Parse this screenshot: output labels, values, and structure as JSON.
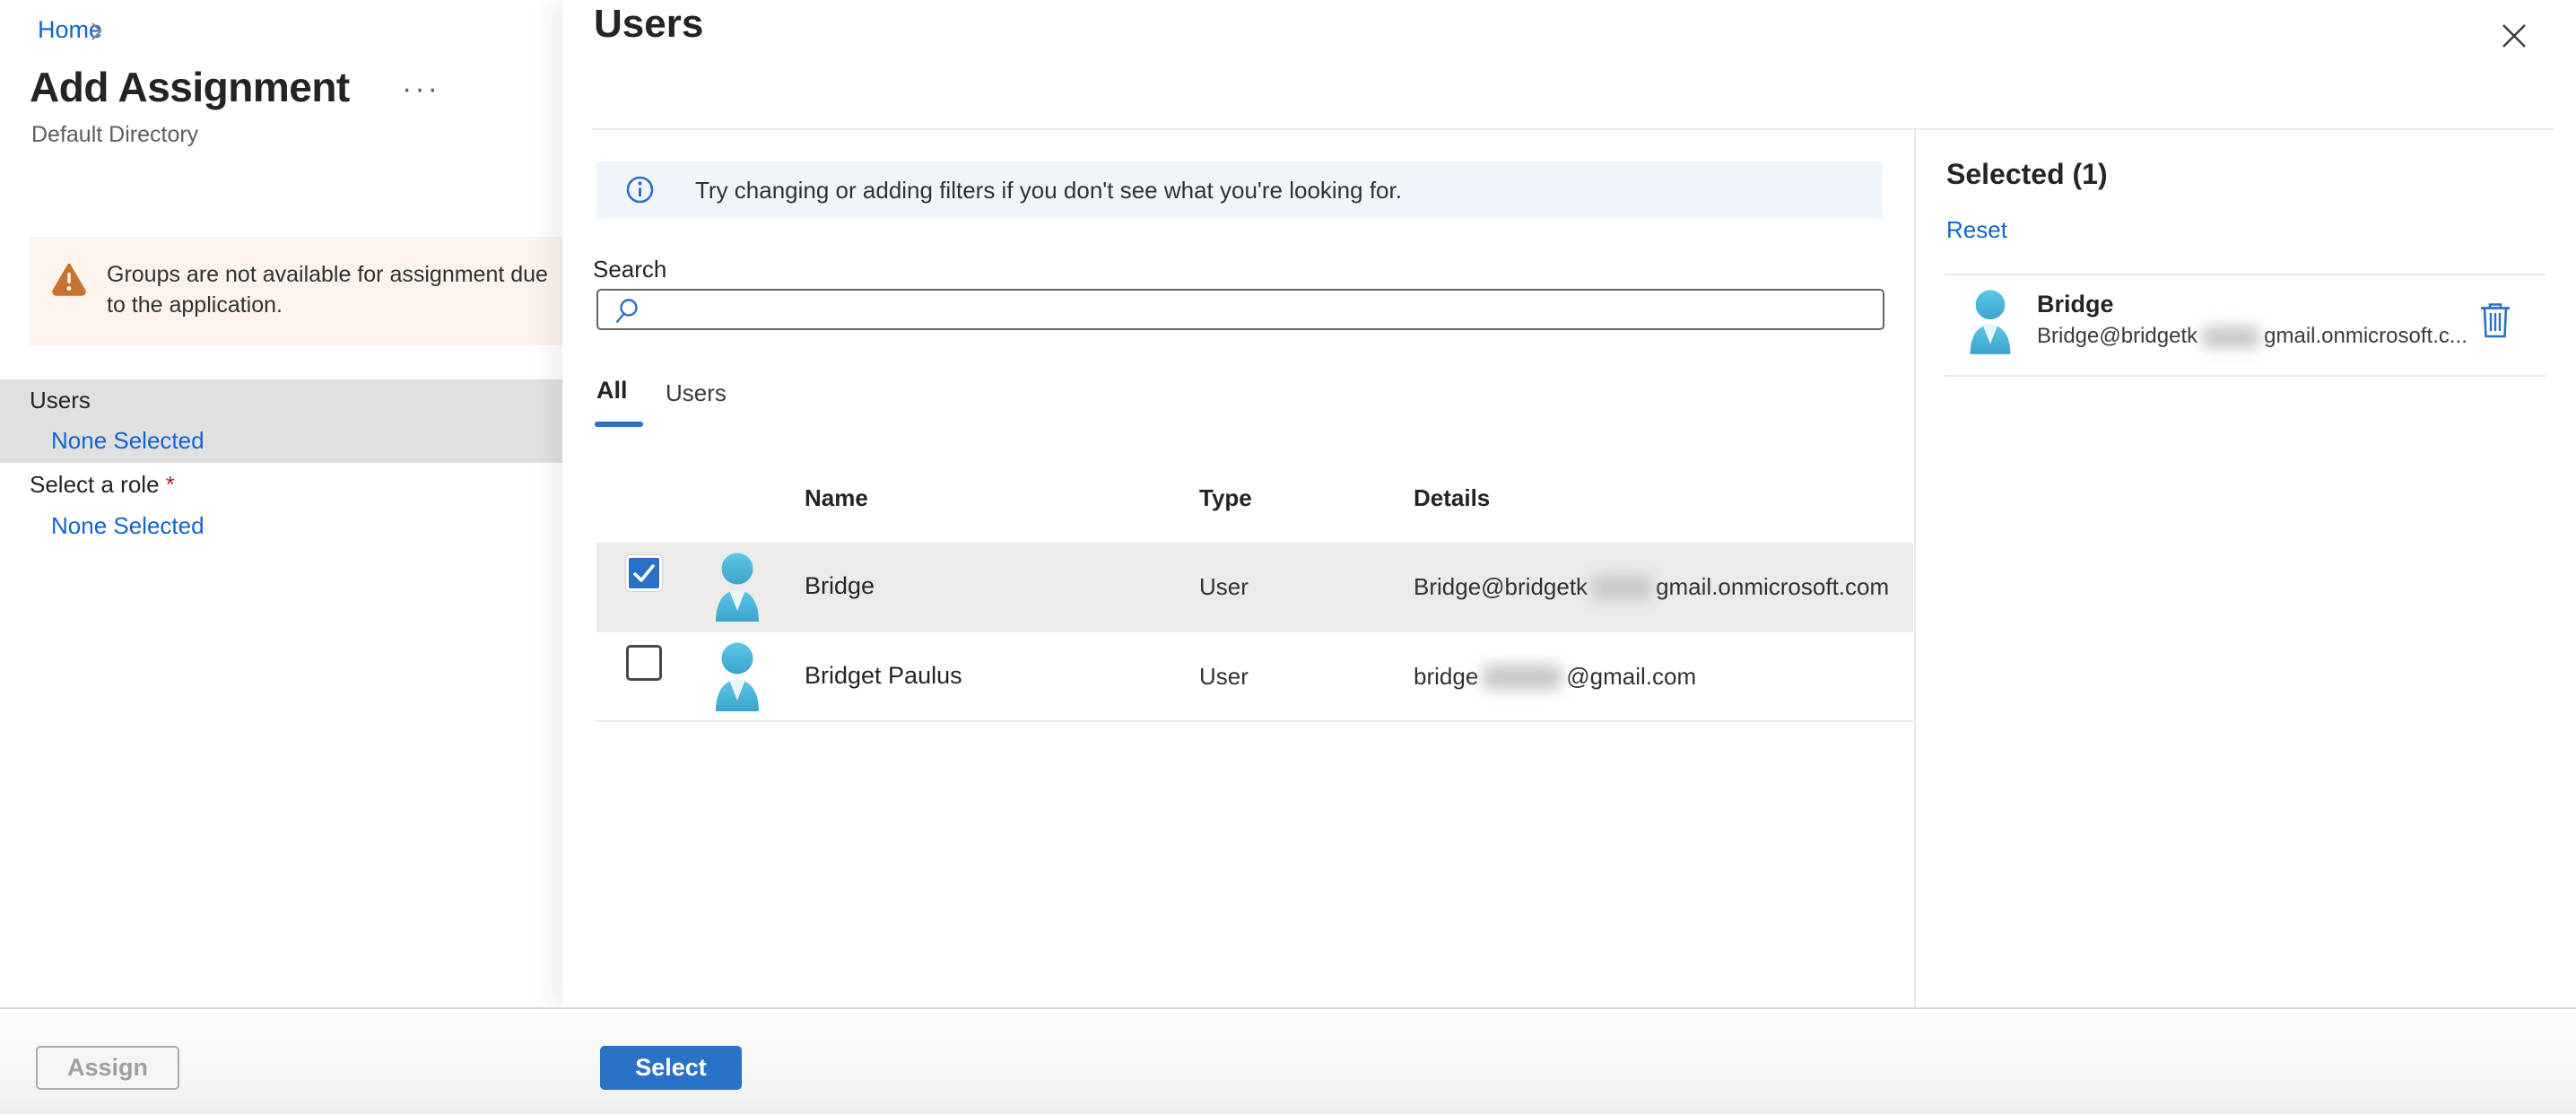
{
  "page": {
    "breadcrumb": {
      "home": "Home"
    },
    "title": "Add Assignment",
    "subtitle": "Default Directory",
    "warning": "Groups are not available for assignment due to the application.",
    "nav": {
      "users_label": "Users",
      "users_value": "None Selected",
      "role_label": "Select a role ",
      "role_required": "*",
      "role_value": "None Selected"
    },
    "assign_button": "Assign"
  },
  "panel": {
    "title": "Users",
    "info_banner": "Try changing or adding filters if you don't see what you're looking for.",
    "search_label": "Search",
    "search_placeholder": "",
    "search_value": "",
    "tabs": [
      {
        "label": "All",
        "active": true
      },
      {
        "label": "Users",
        "active": false
      }
    ],
    "table": {
      "columns": [
        "Name",
        "Type",
        "Details"
      ],
      "rows": [
        {
          "name": "Bridge",
          "type": "User",
          "details_prefix": "Bridge@bridgetk",
          "details_redacted": true,
          "details_suffix": "gmail.onmicrosoft.com",
          "checked": true
        },
        {
          "name": "Bridget Paulus",
          "type": "User",
          "details_prefix": "bridge",
          "details_redacted": true,
          "details_suffix": "@gmail.com",
          "checked": false
        }
      ]
    },
    "select_button": "Select"
  },
  "selected_panel": {
    "title": "Selected (1)",
    "reset_label": "Reset",
    "items": [
      {
        "name": "Bridge",
        "email_prefix": "Bridge@bridgetk",
        "email_redacted": true,
        "email_suffix": "gmail.onmicrosoft.c..."
      }
    ]
  },
  "icons": [
    "breadcrumb-chevron-icon",
    "ellipsis-icon",
    "warning-triangle-icon",
    "info-icon",
    "search-icon",
    "user-avatar-icon",
    "checkbox-checked-icon",
    "checkbox-unchecked-icon",
    "trash-icon",
    "close-icon"
  ],
  "colors": {
    "link_blue": "#1065CF",
    "accent_blue": "#2A70C7",
    "selected_row_gray": "#ECEBEA",
    "nav_highlight_gray": "#E0E0E0",
    "warning_bg": "#FBF3EC",
    "warning_icon_orange": "#C9722E",
    "info_bg": "#F0F5FC",
    "required_red": "#A4262C",
    "text_dark": "#252423",
    "text_muted": "#605E5C"
  }
}
